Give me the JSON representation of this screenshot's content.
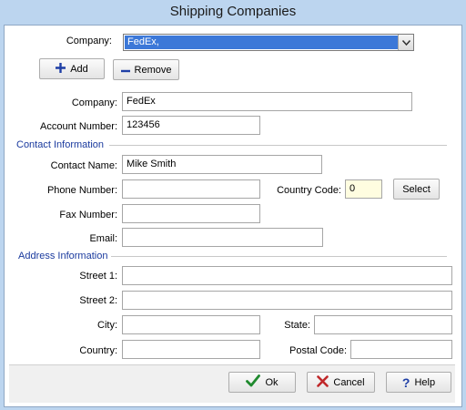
{
  "window": {
    "title": "Shipping Companies"
  },
  "selector": {
    "label": "Company:",
    "value": "FedEx,"
  },
  "toolbar": {
    "add_label": "Add",
    "remove_label": "Remove"
  },
  "company": {
    "label": "Company:",
    "value": "FedEx"
  },
  "account": {
    "label": "Account Number:",
    "value": "123456"
  },
  "contact": {
    "section_title": "Contact Information",
    "name_label": "Contact Name:",
    "name_value": "Mike Smith",
    "phone_label": "Phone Number:",
    "phone_value": "",
    "country_code_label": "Country Code:",
    "country_code_value": "0",
    "select_label": "Select",
    "fax_label": "Fax Number:",
    "fax_value": "",
    "email_label": "Email:",
    "email_value": ""
  },
  "address": {
    "section_title": "Address Information",
    "street1_label": "Street 1:",
    "street1_value": "",
    "street2_label": "Street 2:",
    "street2_value": "",
    "city_label": "City:",
    "city_value": "",
    "state_label": "State:",
    "state_value": "",
    "country_label": "Country:",
    "country_value": "",
    "postal_label": "Postal Code:",
    "postal_value": ""
  },
  "footer": {
    "ok_label": "Ok",
    "cancel_label": "Cancel",
    "help_label": "Help"
  },
  "colors": {
    "section": "#1a3a9e",
    "selection": "#3c78d8",
    "window_bg": "#bcd5ef"
  }
}
